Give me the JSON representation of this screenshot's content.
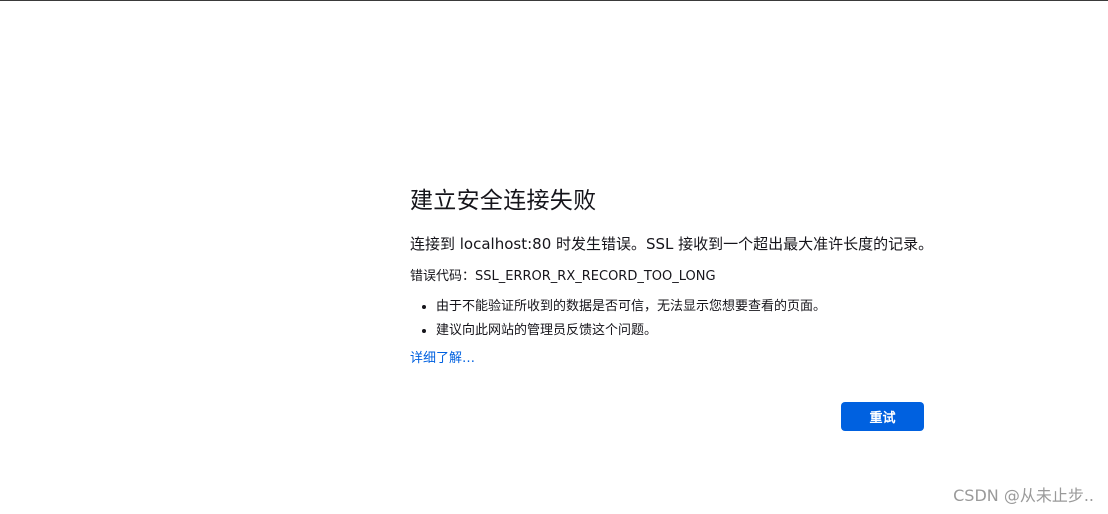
{
  "error_page": {
    "title": "建立安全连接失败",
    "short_desc": "连接到 localhost:80 时发生错误。SSL 接收到一个超出最大准许长度的记录。",
    "error_code_label": "错误代码：",
    "error_code": "SSL_ERROR_RX_RECORD_TOO_LONG",
    "bullets": [
      "由于不能验证所收到的数据是否可信，无法显示您想要查看的页面。",
      "建议向此网站的管理员反馈这个问题。"
    ],
    "learn_more_label": "详细了解…",
    "retry_label": "重试"
  },
  "watermark": "CSDN @从未止步..",
  "colors": {
    "accent": "#0061e0",
    "text": "#15141a",
    "watermark": "#9a9a9a"
  }
}
